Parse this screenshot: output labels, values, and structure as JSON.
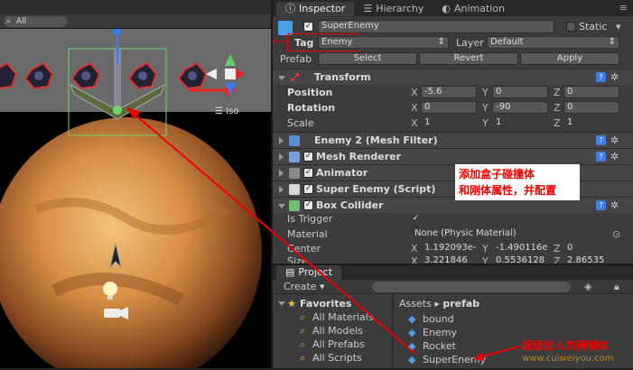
{
  "scene": {
    "search_text": "All",
    "iso_label": "Iso"
  },
  "inspector": {
    "tabs": [
      {
        "label": "Inspector",
        "icon": "info-icon"
      },
      {
        "label": "Hierarchy",
        "icon": "list-icon"
      },
      {
        "label": "Animation",
        "icon": "animation-icon"
      }
    ],
    "object_name": "SuperEnemy",
    "static_label": "Static",
    "tag_label": "Tag",
    "tag_value": "Enemy",
    "layer_label": "Layer",
    "layer_value": "Default",
    "prefab_label": "Prefab",
    "prefab_buttons": [
      "Select",
      "Revert",
      "Apply"
    ],
    "transform": {
      "title": "Transform",
      "rows": [
        {
          "label": "Position",
          "x": "-5.6",
          "y": "0",
          "z": "0"
        },
        {
          "label": "Rotation",
          "x": "0",
          "y": "-90",
          "z": "0"
        },
        {
          "label": "Scale",
          "x": "1",
          "y": "1",
          "z": "1"
        }
      ]
    },
    "components": [
      {
        "title": "Enemy 2 (Mesh Filter)",
        "icon": "mesh-filter-icon",
        "checkbox": false
      },
      {
        "title": "Mesh Renderer",
        "icon": "mesh-renderer-icon",
        "checkbox": true
      },
      {
        "title": "Animator",
        "icon": "animator-icon",
        "checkbox": true
      },
      {
        "title": "Super Enemy (Script)",
        "icon": "script-icon",
        "checkbox": true
      },
      {
        "title": "Box Collider",
        "icon": "box-collider-icon",
        "checkbox": true
      }
    ],
    "box_collider": {
      "is_trigger_label": "Is Trigger",
      "material_label": "Material",
      "material_value": "None (Physic Material)",
      "center_label": "Center",
      "center": {
        "x": "1.192093e-",
        "y": "-1.490116e",
        "z": "0"
      },
      "size_label": "Size",
      "size": {
        "x": "3.221846",
        "y": "0.5536128",
        "z": "2.86535"
      }
    },
    "annotation": "添加盒子碰撞体\n和刚体属性，并配置"
  },
  "project": {
    "tab": "Project",
    "create_label": "Create",
    "favorites_label": "Favorites",
    "favorites": [
      "All Materials",
      "All Models",
      "All Prefabs",
      "All Scripts"
    ],
    "breadcrumb_root": "Assets",
    "breadcrumb_folder": "prefab",
    "assets": [
      "bound",
      "Enemy",
      "Rocket",
      "SuperEnemy"
    ],
    "annotation": "超级敌人的预制体",
    "watermark": "www.cuiweiyou.com"
  },
  "colors": {
    "annotation_red": "#e00000",
    "selection_green": "#6fd66f"
  }
}
